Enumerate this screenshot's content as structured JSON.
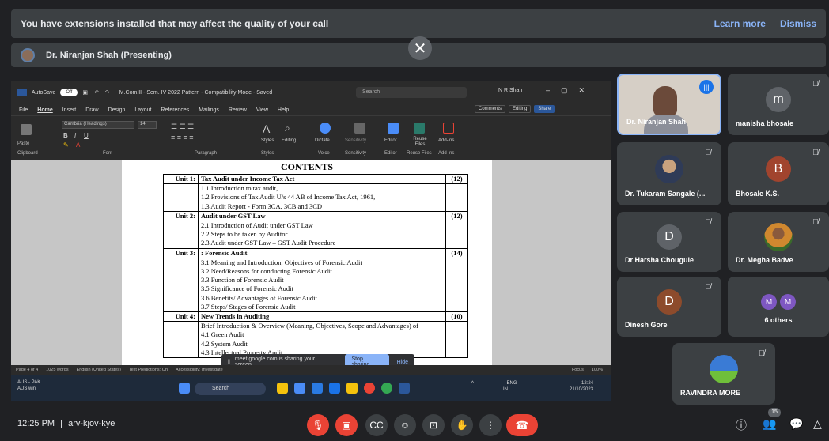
{
  "extension_warning": {
    "message": "You have extensions installed that may affect the quality of your call",
    "learn_more": "Learn more",
    "dismiss": "Dismiss"
  },
  "presenting_bar": {
    "presenter": "Dr. Niranjan Shah (Presenting)"
  },
  "word": {
    "autosave": "AutoSave",
    "autosave_state": "Off",
    "doc_title": "M.Com.II - Sem. IV 2022 Pattern  -  Compatibility Mode  -  Saved",
    "search": "Search",
    "user": "N R Shah",
    "menu": [
      "File",
      "Home",
      "Insert",
      "Draw",
      "Design",
      "Layout",
      "References",
      "Mailings",
      "Review",
      "View",
      "Help"
    ],
    "comments": "Comments",
    "editing": "Editing",
    "share": "Share",
    "ribbon_groups": [
      "Clipboard",
      "Font",
      "Paragraph",
      "Styles",
      "Voice",
      "Sensitivity",
      "Editor",
      "Reuse Files",
      "Add-ins"
    ],
    "ribbon_buttons": {
      "paste": "Paste",
      "font_name": "Cambria (Headings)",
      "font_size": "14",
      "styles": "Styles",
      "editing": "Editing",
      "dictate": "Dictate",
      "sensitivity": "Sensitivity",
      "editor": "Editor",
      "reuse_files": "Reuse Files",
      "add_ins": "Add-ins"
    },
    "status": [
      "Page 4 of 4",
      "1025 words",
      "English (United States)",
      "Text Predictions: On",
      "Accessibility: Investigate"
    ],
    "focus": "Focus",
    "zoom": "100%"
  },
  "document": {
    "heading": "CONTENTS",
    "units": [
      {
        "unit": "Unit 1:",
        "title": "Tax Audit under Income Tax Act",
        "hours": "(12)",
        "items": [
          "1.1 Introduction to tax audit,",
          "1.2 Provisions of Tax Audit U/s 44 AB of Income Tax Act, 1961,",
          "1.3 Audit Report - Form 3CA, 3CB and 3CD"
        ]
      },
      {
        "unit": "Unit 2:",
        "title": "Audit under GST Law",
        "hours": "(12)",
        "items": [
          "2.1 Introduction of Audit under GST Law",
          "2.2 Steps to be taken by Auditor",
          "2.3 Audit under GST Law – GST Audit Procedure"
        ]
      },
      {
        "unit": "Unit 3:",
        "title": ": Forensic Audit",
        "hours": "(14)",
        "items": [
          "3.1 Meaning and Introduction, Objectives of Forensic Audit",
          "3.2 Need/Reasons for conducting Forensic Audit",
          "3.3 Function of Forensic Audit",
          "3.5 Significance of Forensic Audit",
          "3.6 Benefits/ Advantages of Forensic Audit",
          "3.7 Steps/ Stages of Forensic Audit"
        ]
      },
      {
        "unit": "Unit 4:",
        "title": "New Trends in Auditing",
        "hours": "(10)",
        "items": [
          "Brief Introduction & Overview (Meaning, Objectives, Scope and Advantages) of",
          "4.1 Green Audit",
          "4.2 System Audit",
          "4.3 Intellectual Property Audit"
        ]
      }
    ]
  },
  "share_notice": {
    "text": "meet.google.com is sharing your screen.",
    "stop": "Stop sharing",
    "hide": "Hide"
  },
  "taskbar": {
    "weather_line1": "AUS - PAK",
    "weather_line2": "AUS win",
    "search": "Search",
    "lang_line1": "ENG",
    "lang_line2": "IN",
    "time": "12:24",
    "date": "21/10/2023"
  },
  "participants": [
    {
      "name": "Dr. Niranjan Shah",
      "kind": "video"
    },
    {
      "name": "manisha bhosale",
      "letter": "m",
      "color": "#5f6368"
    },
    {
      "name": "Dr. Tukaram Sangale (...",
      "kind": "photo"
    },
    {
      "name": "Bhosale K.S.",
      "letter": "B",
      "color": "#a1442e"
    },
    {
      "name": "Dr Harsha Chougule",
      "letter": "D",
      "color": "#5f6368"
    },
    {
      "name": "Dr. Megha Badve",
      "kind": "photo"
    },
    {
      "name": "Dinesh Gore",
      "letter": "D",
      "color": "#8d4b2c"
    },
    {
      "name": "6 others",
      "letters": [
        "M",
        "M"
      ]
    },
    {
      "name": "RAVINDRA MORE",
      "kind": "photo"
    }
  ],
  "meeting": {
    "time": "12:25 PM",
    "separator": "|",
    "code": "arv-kjov-kye",
    "participant_count": "15"
  }
}
